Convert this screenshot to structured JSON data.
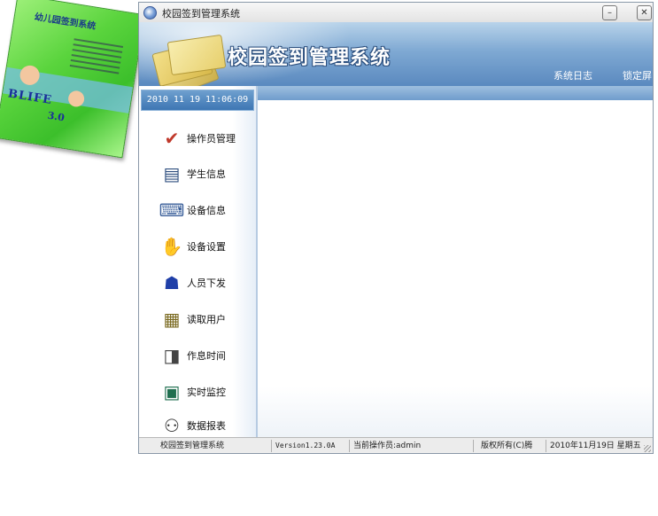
{
  "box_art": {
    "title": "幼儿园签到系统",
    "brand": "BLIFE",
    "version": "3.0"
  },
  "window": {
    "title": "校园签到管理系统",
    "minimize_glyph": "–",
    "close_glyph": "✕"
  },
  "banner": {
    "title": "校园签到管理系统",
    "links": {
      "system_log": "系统日志",
      "lock_screen": "锁定屏"
    }
  },
  "sidebar": {
    "datetime": "2010 11 19 11:06:09",
    "items": [
      {
        "label": "操作员管理",
        "icon": "operator-icon",
        "glyph": "✔"
      },
      {
        "label": "学生信息",
        "icon": "student-info-icon",
        "glyph": "▤"
      },
      {
        "label": "设备信息",
        "icon": "device-info-icon",
        "glyph": "⌨"
      },
      {
        "label": "设备设置",
        "icon": "device-settings-icon",
        "glyph": "✋"
      },
      {
        "label": "人员下发",
        "icon": "person-dispatch-icon",
        "glyph": "☗"
      },
      {
        "label": "读取用户",
        "icon": "read-users-icon",
        "glyph": "▦"
      },
      {
        "label": "作息时间",
        "icon": "schedule-icon",
        "glyph": "◨"
      },
      {
        "label": "实时监控",
        "icon": "monitor-icon",
        "glyph": "▣"
      },
      {
        "label": "数据报表",
        "icon": "data-report-icon",
        "glyph": "⚇"
      }
    ]
  },
  "statusbar": {
    "app_name": "校园签到管理系统",
    "version": "Version1.23.0A",
    "operator": "当前操作员:admin",
    "copyright": "版权所有(C)腾",
    "date": "2010年11月19日 星期五"
  },
  "colors": {
    "banner": "#7fa9d3",
    "datetime_bg": "#3d76b3",
    "content_bar": "#6f9ccc"
  }
}
